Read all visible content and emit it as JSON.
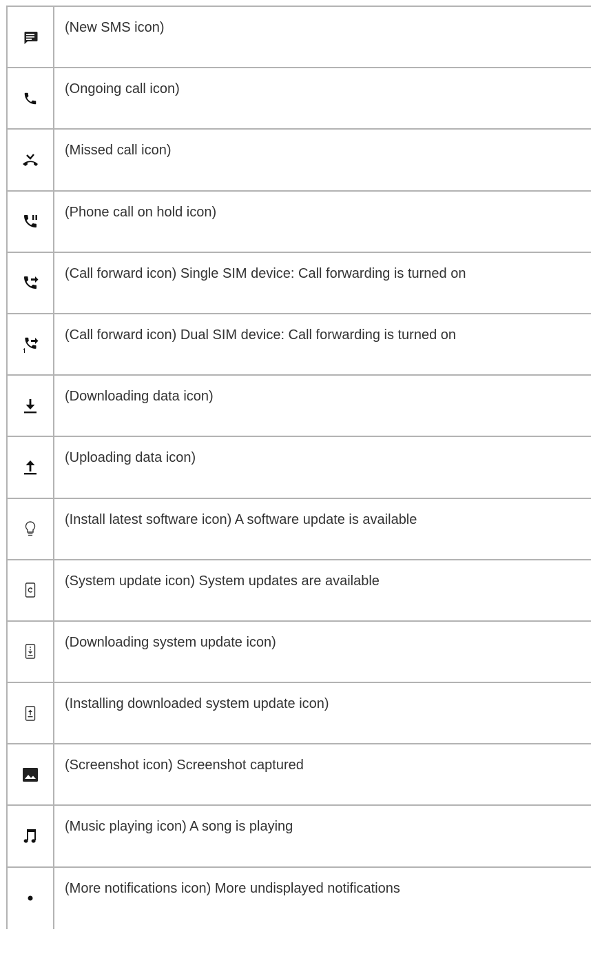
{
  "rows": [
    {
      "icon": "new-sms-icon",
      "text": "(New SMS icon)"
    },
    {
      "icon": "ongoing-call-icon",
      "text": "(Ongoing call icon)"
    },
    {
      "icon": "missed-call-icon",
      "text": "(Missed call icon)"
    },
    {
      "icon": "call-on-hold-icon",
      "text": "(Phone call on hold icon)"
    },
    {
      "icon": "call-forward-icon",
      "text": "(Call forward icon) Single SIM device: Call forwarding is turned on"
    },
    {
      "icon": "call-forward-sim1-icon",
      "text": "(Call forward icon) Dual SIM device: Call forwarding is turned on"
    },
    {
      "icon": "downloading-data-icon",
      "text": "(Downloading data icon)"
    },
    {
      "icon": "uploading-data-icon",
      "text": "(Uploading data icon)"
    },
    {
      "icon": "lightbulb-icon",
      "text": "(Install latest software icon) A software update is available"
    },
    {
      "icon": "system-update-icon",
      "text": "(System update icon) System updates are available"
    },
    {
      "icon": "downloading-system-update-icon",
      "text": "(Downloading system update icon)"
    },
    {
      "icon": "installing-system-update-icon",
      "text": "(Installing downloaded system update icon)"
    },
    {
      "icon": "screenshot-icon",
      "text": "(Screenshot icon) Screenshot captured"
    },
    {
      "icon": "music-note-icon",
      "text": "(Music playing icon) A song is playing"
    },
    {
      "icon": "dot-icon",
      "text": "(More notifications icon) More undisplayed notifications"
    }
  ]
}
